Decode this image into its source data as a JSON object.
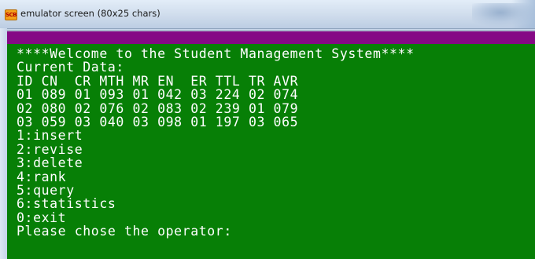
{
  "window": {
    "title": "emulator screen (80x25 chars)",
    "app_icon_text": "SCB"
  },
  "console": {
    "lines": [
      "****Welcome to the Student Management System****",
      "Current Data:",
      "ID CN  CR MTH MR EN  ER TTL TR AVR",
      "01 089 01 093 01 042 03 224 02 074",
      "02 080 02 076 02 083 02 239 01 079",
      "03 059 03 040 03 098 01 197 03 065",
      "1:insert",
      "2:revise",
      "3:delete",
      "4:rank",
      "5:query",
      "6:statistics",
      "0:exit",
      "Please chose the operator:"
    ]
  },
  "colors": {
    "terminal_background": "#077f06",
    "terminal_text": "#ffffff",
    "status_bar": "#850985",
    "title_bar": "#cfdcec"
  }
}
